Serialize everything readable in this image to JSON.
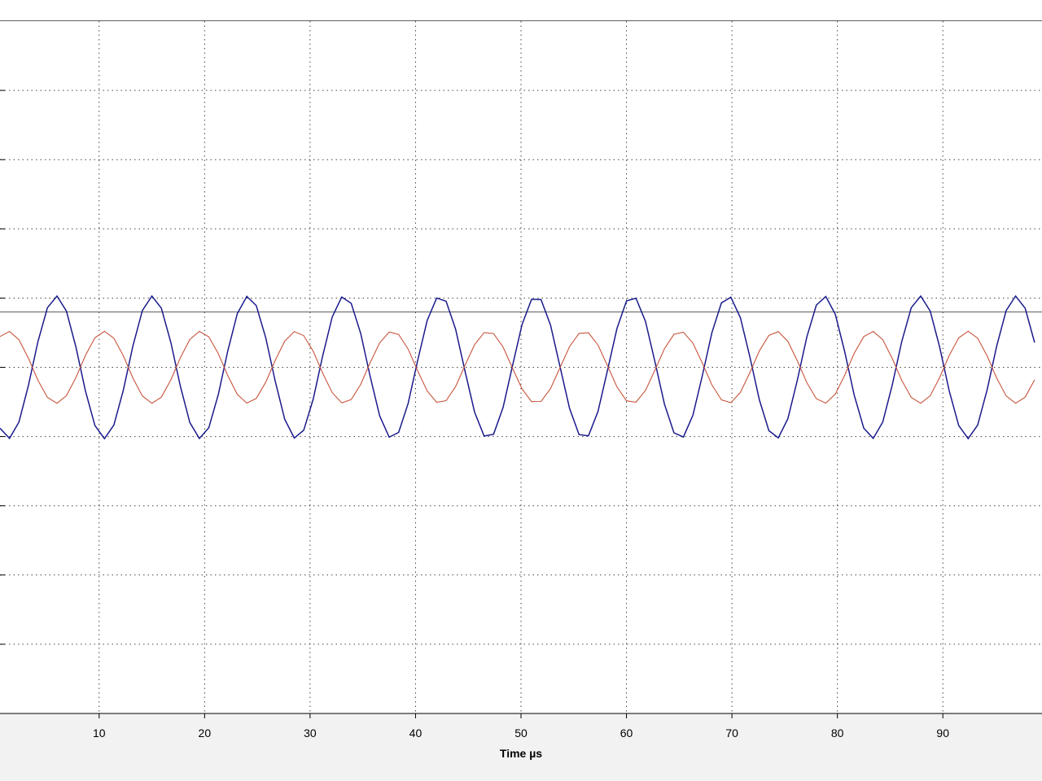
{
  "chart_data": {
    "type": "line",
    "title": "",
    "xlabel": "Time µs",
    "ylabel": "",
    "xlim": [
      0.6,
      99.4
    ],
    "ylim": [
      -5,
      5
    ],
    "grid": true,
    "x_ticks": [
      10,
      20,
      30,
      40,
      50,
      60,
      70,
      80,
      90
    ],
    "y_ticks": [
      -4,
      -3,
      -2,
      -1,
      0,
      1,
      2,
      3,
      4
    ],
    "threshold_line": 0.8,
    "series": [
      {
        "color": "#1a1a8c",
        "amplitude": 1.03,
        "period_us": 9.1,
        "phase_deg": -145,
        "step_us": 0.9
      },
      {
        "color": "#c8553d",
        "amplitude": 0.52,
        "period_us": 9.1,
        "phase_deg": 35,
        "step_us": 0.9
      }
    ]
  }
}
